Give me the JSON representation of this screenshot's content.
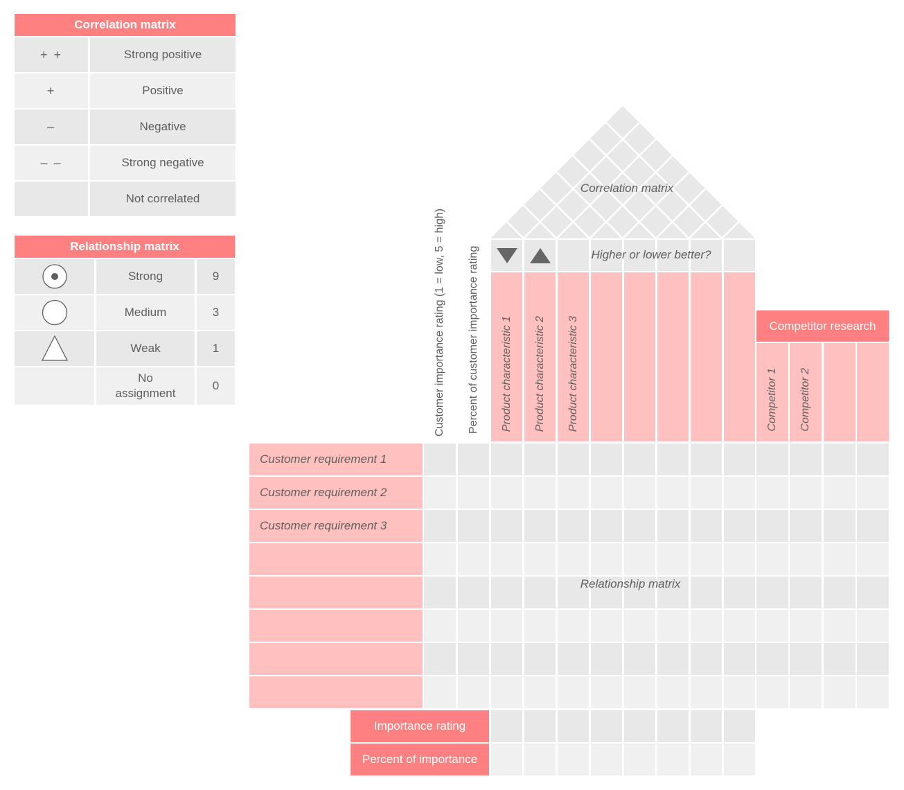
{
  "legend_correlation": {
    "title": "Correlation matrix",
    "rows": [
      {
        "symbol": "+ +",
        "label": "Strong positive"
      },
      {
        "symbol": "+",
        "label": "Positive"
      },
      {
        "symbol": "–",
        "label": "Negative"
      },
      {
        "symbol": "– –",
        "label": "Strong negative"
      },
      {
        "symbol": "",
        "label": "Not correlated"
      }
    ]
  },
  "legend_relationship": {
    "title": "Relationship matrix",
    "rows": [
      {
        "icon": "strong-circle-dot-icon",
        "label": "Strong",
        "value": "9"
      },
      {
        "icon": "medium-circle-icon",
        "label": "Medium",
        "value": "3"
      },
      {
        "icon": "weak-triangle-icon",
        "label": "Weak",
        "value": "1"
      },
      {
        "icon": "",
        "label": "No assignment",
        "value": "0"
      }
    ]
  },
  "house": {
    "roof_label": "Correlation matrix",
    "direction_label": "Higher or lower better?",
    "direction_icons": [
      "arrow-down-triangle-icon",
      "arrow-up-triangle-icon"
    ],
    "side_headers": [
      "Customer importance  rating (1 = low, 5 = high)",
      "Percent of customer importance rating"
    ],
    "product_characteristics": [
      "Product characteristic 1",
      "Product characteristic 2",
      "Product characteristic 3",
      "",
      "",
      "",
      "",
      ""
    ],
    "competitor_header": "Competitor research",
    "competitors": [
      "Competitor 1",
      "Competitor 2",
      "",
      ""
    ],
    "customer_requirements": [
      "Customer requirement 1",
      "Customer requirement 2",
      "Customer requirement 3",
      "",
      "",
      "",
      "",
      ""
    ],
    "relationship_label": "Relationship matrix",
    "bottom_rows": [
      "Importance rating",
      "Percent of importance"
    ]
  },
  "colors": {
    "header": "#ff8080",
    "pink": "#ffc0c0",
    "grey_dark": "#e8e8e8",
    "grey_light": "#eff0ef",
    "text": "#5f5f5f"
  }
}
